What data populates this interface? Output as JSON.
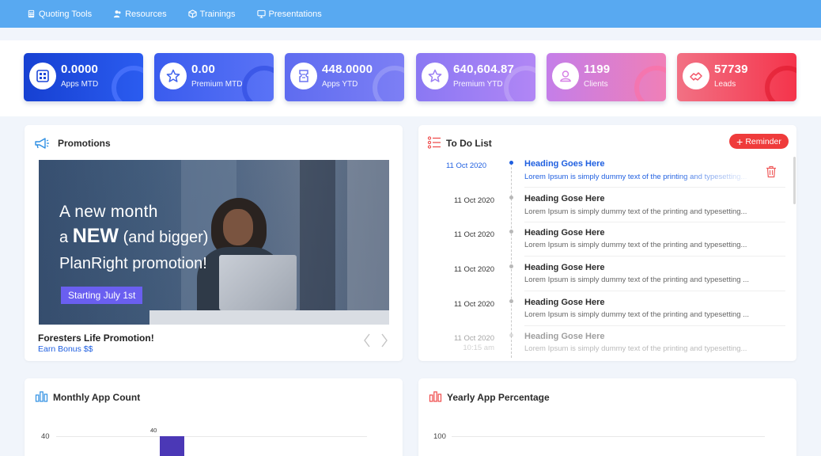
{
  "nav": {
    "items": [
      {
        "label": "Quoting Tools",
        "icon": "calculator-icon"
      },
      {
        "label": "Resources",
        "icon": "users-icon"
      },
      {
        "label": "Trainings",
        "icon": "cube-icon"
      },
      {
        "label": "Presentations",
        "icon": "monitor-icon"
      }
    ]
  },
  "stats": [
    {
      "value": "0.0000",
      "label": "Apps MTD",
      "icon": "calendar-grid-icon",
      "color": "#1d47d8"
    },
    {
      "value": "0.00",
      "label": "Premium MTD",
      "icon": "star-icon",
      "color": "#3f63ee"
    },
    {
      "value": "448.0000",
      "label": "Apps YTD",
      "icon": "ticket-icon",
      "color": "#6b74f2"
    },
    {
      "value": "640,604.87",
      "label": "Premium YTD",
      "icon": "star-icon",
      "color": "#9b7ff4"
    },
    {
      "value": "1199",
      "label": "Clients",
      "icon": "client-icon",
      "color": "#d680e6"
    },
    {
      "value": "57739",
      "label": "Leads",
      "icon": "handshake-icon",
      "color": "#f25164"
    }
  ],
  "promotions": {
    "title": "Promotions",
    "banner": {
      "line1": "A new  month",
      "line2_prefix": "a ",
      "line2_big": "NEW",
      "line2_suffix": " (and bigger)",
      "line3": "PlanRight promotion!",
      "cta": "Starting July 1st"
    },
    "caption_title": "Foresters Life Promotion!",
    "caption_sub": "Earn Bonus $$"
  },
  "todo": {
    "title": "To Do List",
    "reminder_label": "Reminder",
    "items": [
      {
        "date": "11 Oct 2020",
        "time": "",
        "heading": "Heading Goes Here",
        "desc": "Lorem Ipsum is simply dummy text of the printing and typesetting..."
      },
      {
        "date": "11 Oct 2020",
        "time": "",
        "heading": "Heading Gose Here",
        "desc": "Lorem Ipsum is simply dummy text of the printing and typesetting..."
      },
      {
        "date": "11 Oct 2020",
        "time": "",
        "heading": "Heading Gose Here",
        "desc": "Lorem Ipsum is simply dummy text of the printing and typesetting..."
      },
      {
        "date": "11 Oct 2020",
        "time": "",
        "heading": "Heading Gose Here",
        "desc": "Lorem Ipsum is simply dummy text of the printing and typesetting ..."
      },
      {
        "date": "11 Oct 2020",
        "time": "",
        "heading": "Heading Gose Here",
        "desc": "Lorem Ipsum is simply dummy text of the printing and typesetting ..."
      },
      {
        "date": "11 Oct 2020",
        "time": "10:15 am",
        "heading": "Heading Gose Here",
        "desc": "Lorem Ipsum is simply dummy text of the printing and typesetting..."
      }
    ]
  },
  "monthly": {
    "title": "Monthly App Count",
    "chart_data": {
      "type": "bar",
      "y_tick": 40,
      "bar_value": 40,
      "bar_label": "40"
    }
  },
  "yearly": {
    "title": "Yearly App Percentage",
    "chart_data": {
      "type": "bar",
      "y_tick": 100
    }
  },
  "colors": {
    "accent": "#58a9f1",
    "active_blue": "#1f5fe0",
    "reminder_red": "#ef3b3b",
    "bar_purple": "#4b38b6"
  }
}
